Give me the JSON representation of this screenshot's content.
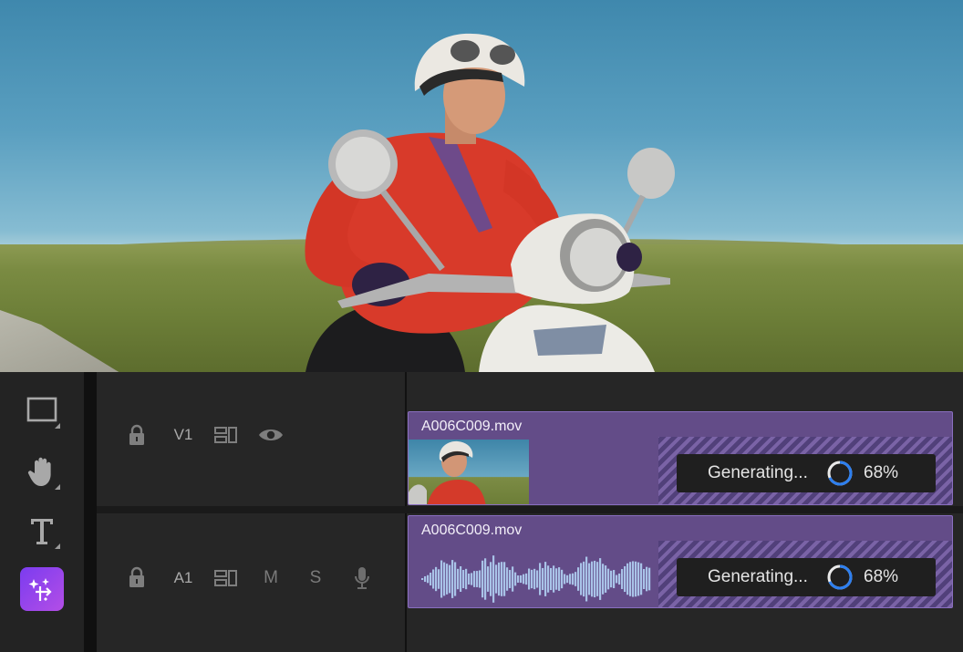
{
  "tools": [
    {
      "name": "rectangle-tool",
      "icon": "rectangle-icon"
    },
    {
      "name": "hand-tool",
      "icon": "hand-icon"
    },
    {
      "name": "type-tool",
      "icon": "text-icon"
    },
    {
      "name": "generative-extend-tool",
      "icon": "generative-extend-icon",
      "active": true
    }
  ],
  "tracks": {
    "video": {
      "label": "V1",
      "icons": [
        "lock-icon",
        "sync-lock-icon",
        "eye-icon"
      ],
      "clip": {
        "name": "A006C009.mov",
        "status": "Generating...",
        "progress_label": "68%",
        "progress": 0.68
      }
    },
    "audio": {
      "label": "A1",
      "mute": "M",
      "solo": "S",
      "icons": [
        "lock-icon",
        "sync-lock-icon",
        "microphone-icon"
      ],
      "clip": {
        "name": "A006C009.mov",
        "status": "Generating...",
        "progress_label": "68%",
        "progress": 0.68
      }
    }
  },
  "colors": {
    "clip": "#634c88",
    "clip_border": "#8a6fc0",
    "spinner": "#2d7ff0",
    "active_tool": "#8a42ec"
  }
}
